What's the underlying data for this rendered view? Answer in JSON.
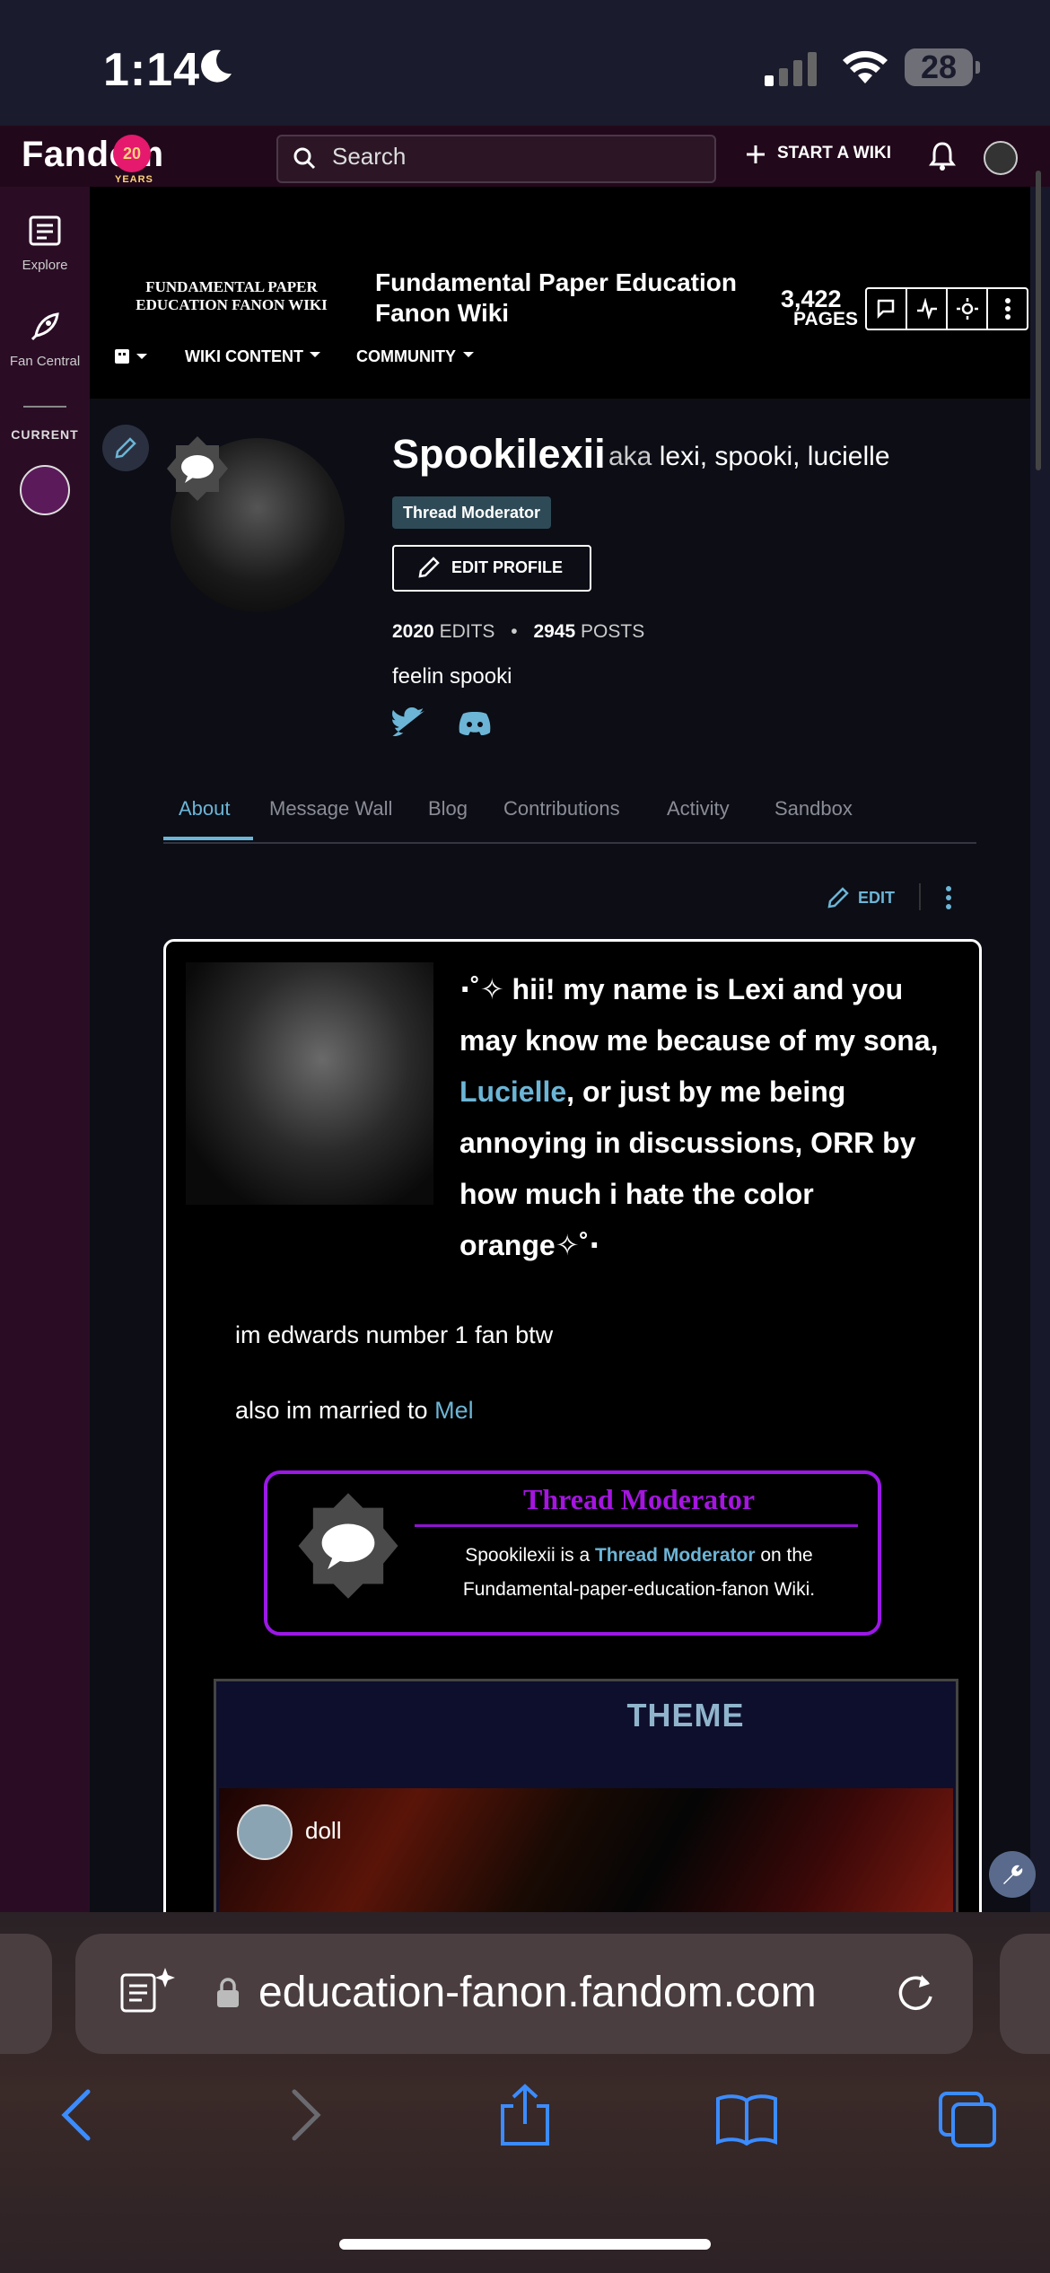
{
  "status_bar": {
    "time": "1:14",
    "battery": "28"
  },
  "fandom_header": {
    "logo_text": "Fandom",
    "anniversary_badge": "20",
    "anniversary_label": "YEARS",
    "search_placeholder": "Search",
    "start_wiki_label": "START A WIKI"
  },
  "left_rail": {
    "items": [
      {
        "label": "Explore"
      },
      {
        "label": "Fan Central"
      }
    ],
    "current_label": "CURRENT"
  },
  "wiki_header": {
    "logo_text": "FUNDAMENTAL PAPER EDUCATION FANON WIKI",
    "title": "Fundamental Paper Education Fanon Wiki",
    "pages_count": "3,422",
    "pages_label": "PAGES",
    "nav": [
      {
        "label": "WIKI CONTENT"
      },
      {
        "label": "COMMUNITY"
      }
    ]
  },
  "profile": {
    "username": "Spookilexii",
    "aka_prefix": "aka",
    "aka_names": "lexi, spooki, lucielle",
    "role_tag": "Thread Moderator",
    "edit_profile_label": "EDIT PROFILE",
    "edits_count": "2020",
    "edits_label": "EDITS",
    "posts_count": "2945",
    "posts_label": "POSTS",
    "bio": "feelin spooki"
  },
  "tabs": [
    {
      "label": "About",
      "active": true
    },
    {
      "label": "Message Wall"
    },
    {
      "label": "Blog"
    },
    {
      "label": "Contributions"
    },
    {
      "label": "Activity"
    },
    {
      "label": "Sandbox"
    }
  ],
  "about": {
    "edit_label": "EDIT",
    "intro_part1": "⋅˚✧ hii! my name is Lexi and you may know me because of my sona, ",
    "intro_link": "Lucielle",
    "intro_part2": ", or just by me being annoying in discussions, ORR by how much i hate the color orange✧˚⋅",
    "line1": "im edwards number 1 fan btw",
    "line2_prefix": "also im married to ",
    "line2_link": "Mel",
    "mod_box": {
      "title": "Thread Moderator",
      "text_prefix": "Spookilexii is a ",
      "text_role": "Thread Moderator",
      "text_suffix": " on the Fundamental-paper-education-fanon Wiki."
    },
    "theme": {
      "title": "THEME",
      "user": "doll"
    }
  },
  "safari": {
    "url_text": "education-fanon.fandom.com"
  },
  "colors": {
    "accent": "#6cb5d6",
    "mod_purple": "#9b18e6",
    "fandom_bar": "#22081b"
  }
}
